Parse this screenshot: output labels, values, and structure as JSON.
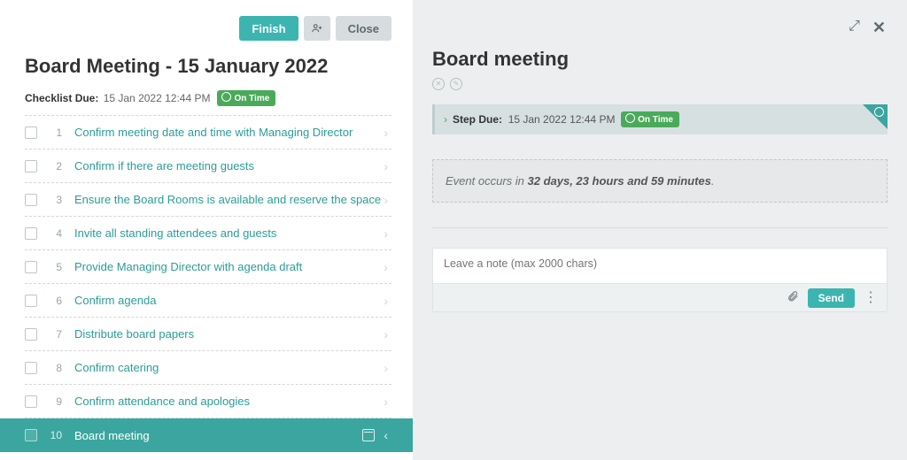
{
  "toolbar": {
    "finish_label": "Finish",
    "close_label": "Close"
  },
  "page_title": "Board Meeting - 15 January 2022",
  "checklist_due": {
    "label": "Checklist Due:",
    "value": "15 Jan 2022 12:44 PM",
    "status": "On Time"
  },
  "items": [
    {
      "n": "1",
      "label": "Confirm meeting date and time with Managing Director",
      "active": false
    },
    {
      "n": "2",
      "label": "Confirm if there are meeting guests",
      "active": false
    },
    {
      "n": "3",
      "label": "Ensure the Board Rooms is available and reserve the space",
      "active": false
    },
    {
      "n": "4",
      "label": "Invite all standing attendees and guests",
      "active": false
    },
    {
      "n": "5",
      "label": "Provide Managing Director with agenda draft",
      "active": false
    },
    {
      "n": "6",
      "label": "Confirm agenda",
      "active": false
    },
    {
      "n": "7",
      "label": "Distribute board papers",
      "active": false
    },
    {
      "n": "8",
      "label": "Confirm catering",
      "active": false
    },
    {
      "n": "9",
      "label": "Confirm attendance and apologies",
      "active": false
    },
    {
      "n": "10",
      "label": "Board meeting",
      "active": true
    }
  ],
  "detail": {
    "title": "Board meeting",
    "step_due_label": "Step Due:",
    "step_due_value": "15 Jan 2022 12:44 PM",
    "step_due_status": "On Time",
    "event_prefix": "Event occurs in ",
    "event_bold": "32 days, 23 hours and 59 minutes",
    "event_suffix": ".",
    "note_placeholder": "Leave a note (max 2000 chars)",
    "send_label": "Send"
  },
  "colors": {
    "accent": "#3cb5b0",
    "accent_dark": "#3ba6a0",
    "green": "#4aaa5a",
    "panel_bg": "#eceeef"
  }
}
